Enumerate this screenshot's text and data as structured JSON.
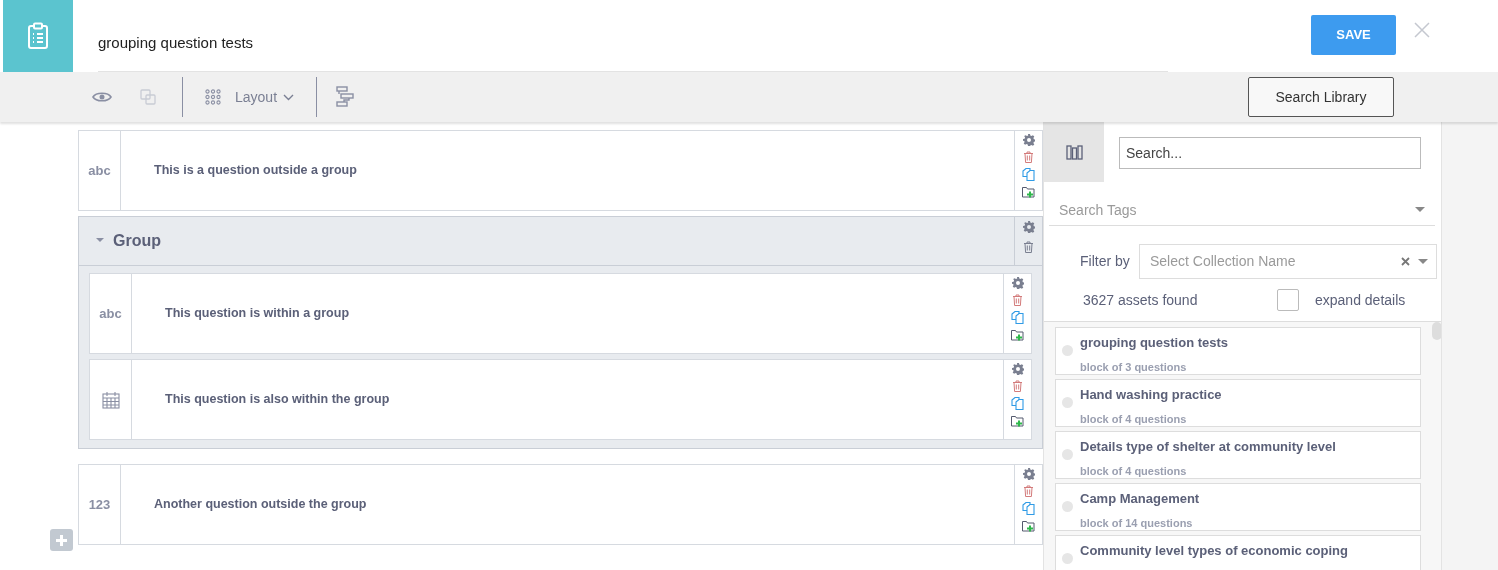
{
  "header": {
    "title": "grouping question tests",
    "save_label": "SAVE"
  },
  "toolbar": {
    "layout_label": "Layout",
    "search_library_label": "Search Library"
  },
  "questions": [
    {
      "kind": "text",
      "type_label": "abc",
      "label": "This is a question outside a group"
    },
    {
      "kind": "group",
      "label": "Group",
      "expanded": true,
      "children": [
        {
          "kind": "text",
          "type_label": "abc",
          "label": "This question is within a group"
        },
        {
          "kind": "date",
          "label": "This question is also within the group"
        }
      ]
    },
    {
      "kind": "number",
      "type_label": "123",
      "label": "Another question outside the group"
    }
  ],
  "library": {
    "search_placeholder": "Search...",
    "tags_placeholder": "Search Tags",
    "filter_label": "Filter by",
    "collection_placeholder": "Select Collection Name",
    "assets_found": "3627 assets found",
    "expand_details": {
      "label": "expand details",
      "checked": false
    },
    "items": [
      {
        "title": "grouping question tests",
        "subtitle": "block of 3 questions"
      },
      {
        "title": "Hand washing practice",
        "subtitle": "block of 4 questions"
      },
      {
        "title": "Details type of shelter at community level",
        "subtitle": "block of 4 questions"
      },
      {
        "title": "Camp Management",
        "subtitle": "block of 14 questions"
      },
      {
        "title": "Community level types of economic coping"
      }
    ]
  }
}
